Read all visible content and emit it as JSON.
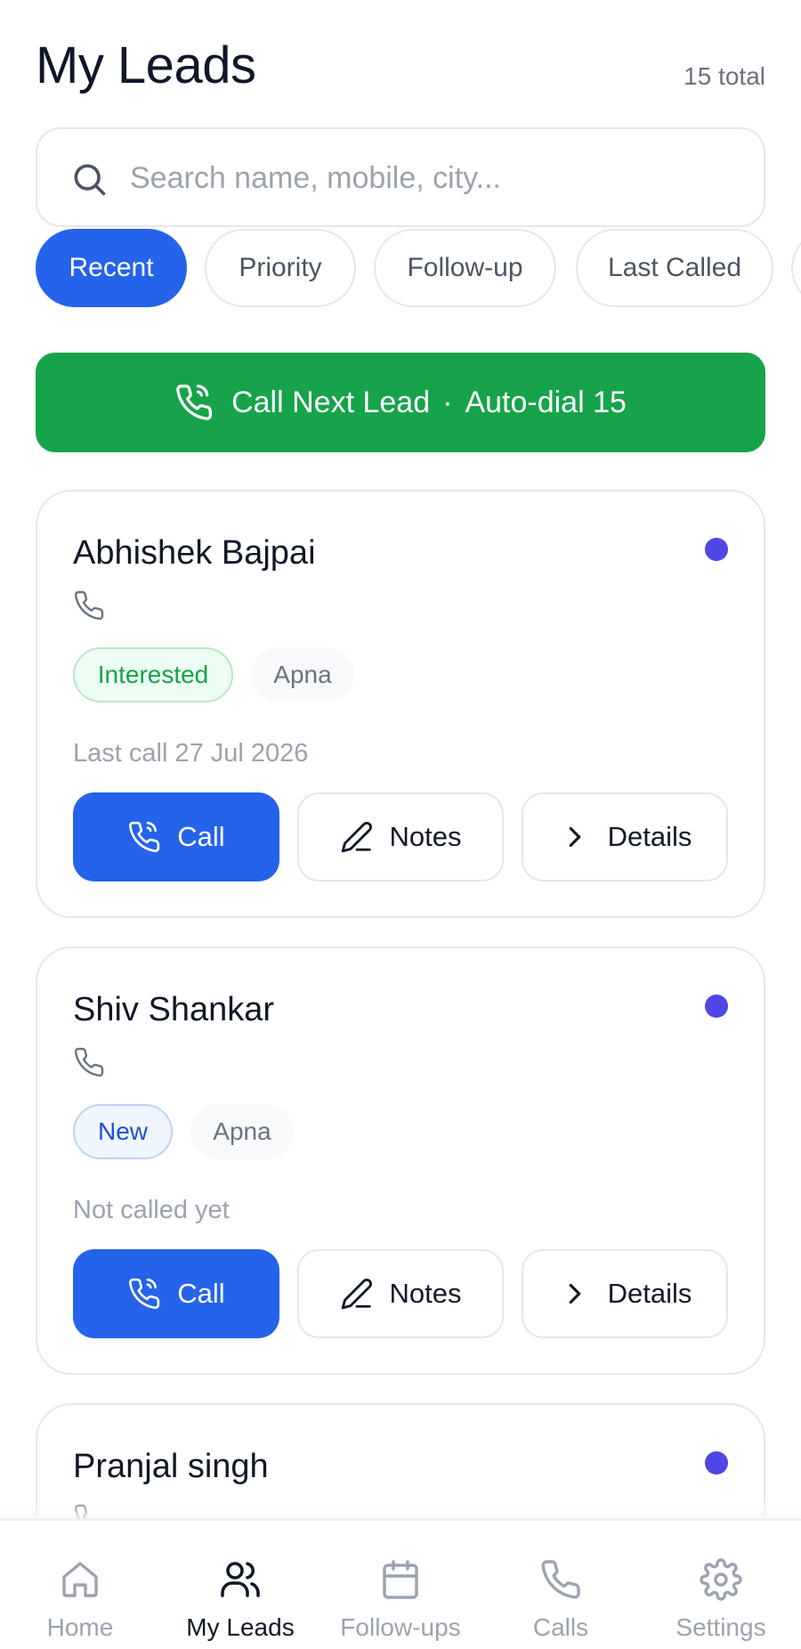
{
  "header": {
    "title": "My Leads",
    "total": "15 total"
  },
  "search": {
    "placeholder": "Search name, mobile, city..."
  },
  "filters": [
    {
      "label": "Recent",
      "active": true
    },
    {
      "label": "Priority",
      "active": false
    },
    {
      "label": "Follow-up",
      "active": false
    },
    {
      "label": "Last Called",
      "active": false
    }
  ],
  "cta": {
    "label": "Call Next Lead",
    "separator": "·",
    "auto_dial": "Auto-dial 15"
  },
  "leads": [
    {
      "name": "Abhishek Bajpai",
      "mobile": "",
      "status": "Interested",
      "source": "Apna",
      "last_call": "Last call 27 Jul 2026",
      "call_label": "Call",
      "notes_label": "Notes",
      "details_label": "Details"
    },
    {
      "name": "Shiv Shankar",
      "mobile": "",
      "status": "New",
      "source": "Apna",
      "last_call": "Not called yet",
      "call_label": "Call",
      "notes_label": "Notes",
      "details_label": "Details"
    },
    {
      "name": "Pranjal singh",
      "mobile": ""
    }
  ],
  "bottom_nav": [
    {
      "label": "Home",
      "icon": "home-icon",
      "active": false
    },
    {
      "label": "My Leads",
      "icon": "users-icon",
      "active": true
    },
    {
      "label": "Follow-ups",
      "icon": "calendar-icon",
      "active": false
    },
    {
      "label": "Calls",
      "icon": "phone-icon",
      "active": false
    },
    {
      "label": "Settings",
      "icon": "gear-icon",
      "active": false
    }
  ],
  "colors": {
    "primary": "#2563eb",
    "cta_green": "#16a34a",
    "indicator_dot": "#4f46e5",
    "interested_bg": "#ecfdf3",
    "interested_text": "#16a34a",
    "new_bg": "#eff6ff",
    "new_text": "#1d4ed8"
  }
}
